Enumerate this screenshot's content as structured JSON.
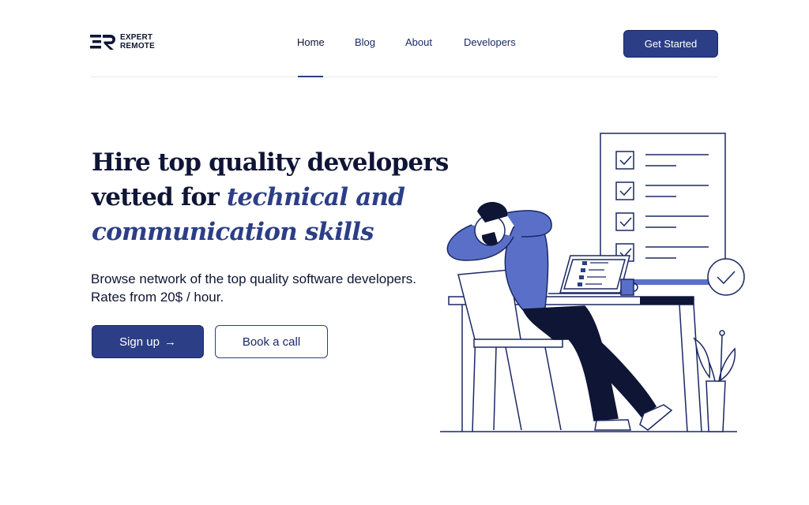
{
  "brand": {
    "line1": "EXPERT",
    "line2": "REMOTE"
  },
  "nav": {
    "items": [
      {
        "label": "Home",
        "active": true
      },
      {
        "label": "Blog",
        "active": false
      },
      {
        "label": "About",
        "active": false
      },
      {
        "label": "Developers",
        "active": false
      }
    ]
  },
  "header": {
    "cta_label": "Get Started"
  },
  "hero": {
    "title_line1": "Hire top quality developers",
    "title_line2_plain": "vetted for ",
    "title_line2_em": "technical and",
    "title_line3_em": "communication skills",
    "subtitle_line1": "Browse network of the top quality software developers.",
    "subtitle_line2": "Rates from 20$ / hour.",
    "primary_button": "Sign up",
    "primary_arrow": "→",
    "secondary_button": "Book a call"
  },
  "colors": {
    "accent": "#2c3e86",
    "accent_light": "#5a70c8",
    "text": "#0f1535"
  },
  "icons": {
    "illustration": "developer-relaxing-illustration",
    "checklist": "checklist-icon",
    "check_circle": "check-circle-icon"
  }
}
